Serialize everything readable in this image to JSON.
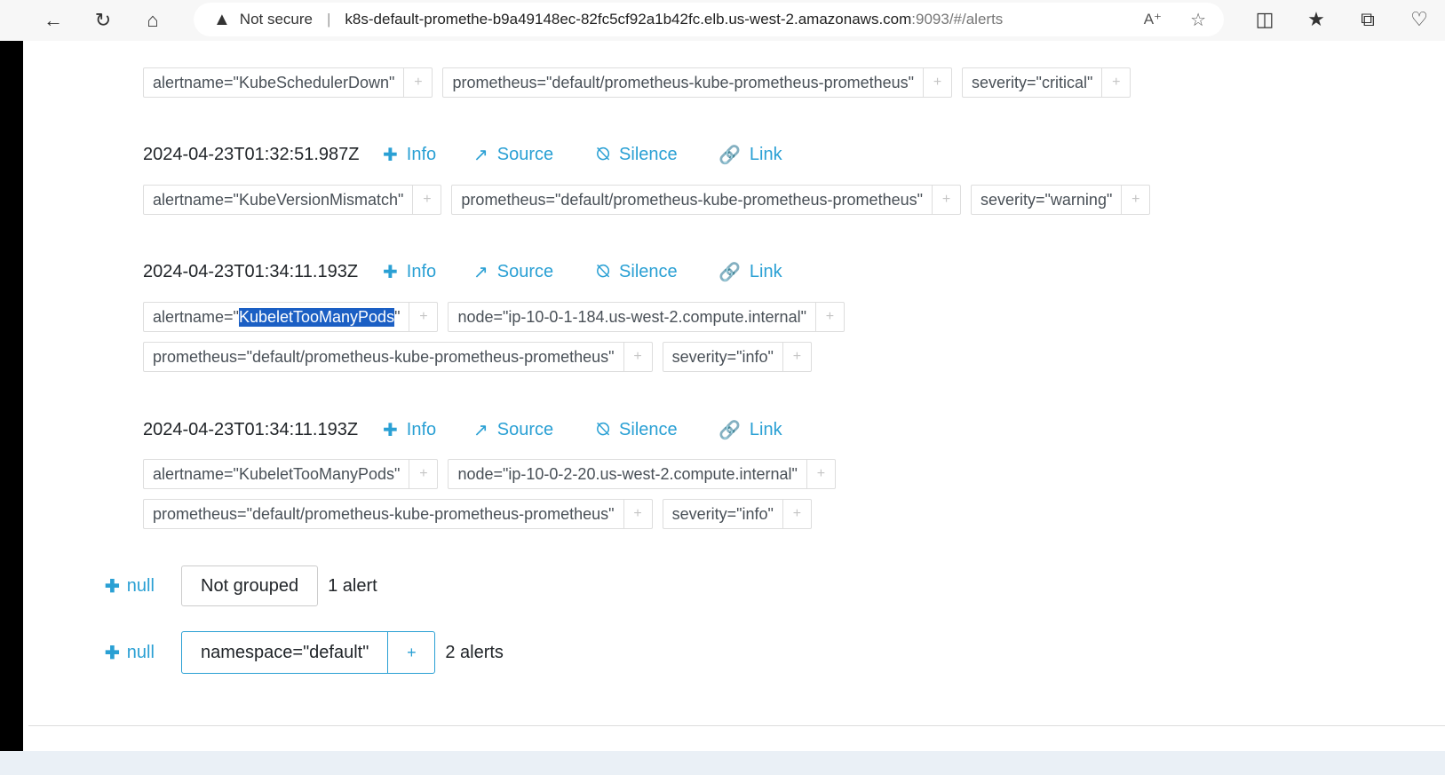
{
  "browser": {
    "not_secure": "Not secure",
    "host": "k8s-default-promethe-b9a49148ec-82fc5cf92a1b42fc.elb.us-west-2.amazonaws.com",
    "path": ":9093/#/alerts"
  },
  "actions": {
    "info": "Info",
    "source": "Source",
    "silence": "Silence",
    "link": "Link"
  },
  "partial_top": {
    "labels": [
      "alertname=\"KubeSchedulerDown\"",
      "prometheus=\"default/prometheus-kube-prometheus-prometheus\"",
      "severity=\"critical\""
    ]
  },
  "alerts": [
    {
      "timestamp": "2024-04-23T01:32:51.987Z",
      "labels": [
        "alertname=\"KubeVersionMismatch\"",
        "prometheus=\"default/prometheus-kube-prometheus-prometheus\"",
        "severity=\"warning\""
      ]
    },
    {
      "timestamp": "2024-04-23T01:34:11.193Z",
      "alertname_prefix": "alertname=\"",
      "alertname_value": "KubeletTooManyPods",
      "alertname_suffix": "\"",
      "labels_row1_rest": [
        "node=\"ip-10-0-1-184.us-west-2.compute.internal\""
      ],
      "labels_row2": [
        "prometheus=\"default/prometheus-kube-prometheus-prometheus\"",
        "severity=\"info\""
      ]
    },
    {
      "timestamp": "2024-04-23T01:34:11.193Z",
      "labels_row1": [
        "alertname=\"KubeletTooManyPods\"",
        "node=\"ip-10-0-2-20.us-west-2.compute.internal\""
      ],
      "labels_row2": [
        "prometheus=\"default/prometheus-kube-prometheus-prometheus\"",
        "severity=\"info\""
      ]
    }
  ],
  "groups": [
    {
      "null_label": "null",
      "group_label": "Not grouped",
      "count": "1 alert"
    },
    {
      "null_label": "null",
      "group_label": "namespace=\"default\"",
      "count": "2 alerts"
    }
  ],
  "plus": "+"
}
